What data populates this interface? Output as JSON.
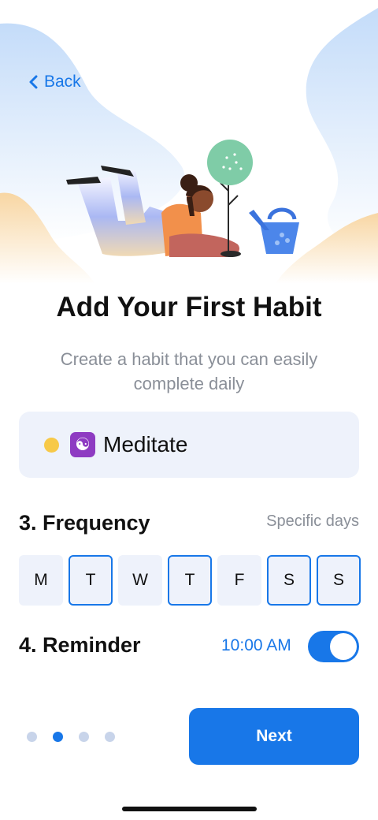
{
  "nav": {
    "back_label": "Back"
  },
  "title": "Add Your First Habit",
  "subtitle": "Create a habit that you can easily complete daily",
  "habit": {
    "color": "#f7c948",
    "icon": "yin-yang-icon",
    "icon_glyph": "☯",
    "name": "Meditate"
  },
  "frequency": {
    "title": "3. Frequency",
    "value": "Specific days",
    "days": [
      {
        "label": "M",
        "selected": false
      },
      {
        "label": "T",
        "selected": true
      },
      {
        "label": "W",
        "selected": false
      },
      {
        "label": "T",
        "selected": true
      },
      {
        "label": "F",
        "selected": false
      },
      {
        "label": "S",
        "selected": true
      },
      {
        "label": "S",
        "selected": true
      }
    ]
  },
  "reminder": {
    "title": "4. Reminder",
    "time": "10:00 AM",
    "enabled": true
  },
  "pager": {
    "total": 4,
    "current": 2
  },
  "next_label": "Next",
  "colors": {
    "accent": "#1877e8",
    "card_bg": "#eef2fb",
    "muted_text": "#8a8f98"
  }
}
